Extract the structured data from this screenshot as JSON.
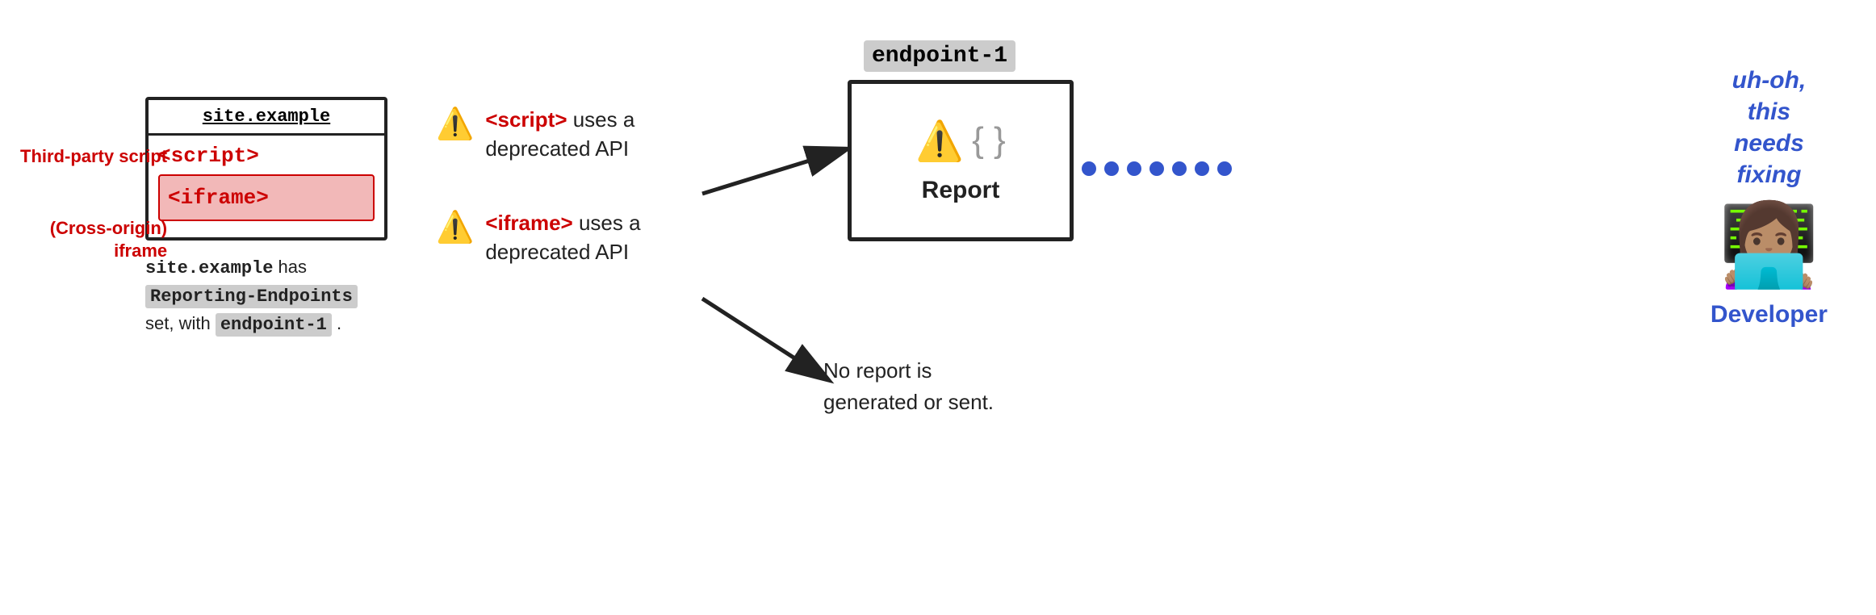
{
  "site_box": {
    "title": "site.example",
    "script_tag": "<script>",
    "iframe_tag": "<iframe>"
  },
  "side_labels": {
    "third_party_script": "Third-party\nscript",
    "cross_origin_iframe": "(Cross-origin)\niframe"
  },
  "description": {
    "line1_code": "site.example",
    "line1_text": " has",
    "line2_code": "Reporting-Endpoints",
    "line3_text": "set, with ",
    "line3_code": "endpoint-1",
    "line3_end": " ."
  },
  "alerts": [
    {
      "icon": "⚠️",
      "tag": "<script>",
      "text": " uses a deprecated API"
    },
    {
      "icon": "⚠️",
      "tag": "<iframe>",
      "text": " uses a deprecated API"
    }
  ],
  "endpoint": {
    "label": "endpoint-1",
    "report_label": "Report"
  },
  "no_report": {
    "text": "No report is\ngenerated or sent."
  },
  "developer": {
    "uh_oh": "uh-oh,\nthis\nneeds\nfixing",
    "emoji": "👩🏽‍💻",
    "label": "Developer"
  },
  "arrows": {
    "arrow1_from": "script alert to endpoint",
    "arrow2_from": "iframe alert to no-report"
  }
}
